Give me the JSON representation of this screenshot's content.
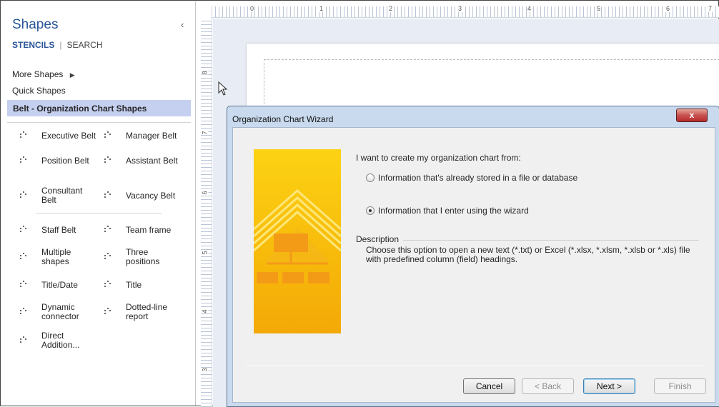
{
  "shapes_pane": {
    "title": "Shapes",
    "collapse_glyph": "‹",
    "tabs": {
      "stencils": "STENCILS",
      "search": "SEARCH"
    },
    "more_shapes": "More Shapes",
    "more_shapes_arrow": "▶",
    "quick_shapes": "Quick Shapes",
    "selected_stencil": "Belt - Organization Chart Shapes",
    "shapes": [
      "Executive Belt",
      "Manager Belt",
      "Position Belt",
      "Assistant Belt",
      "Consultant Belt",
      "Vacancy Belt",
      "Staff Belt",
      "Team frame",
      "Multiple shapes",
      "Three positions",
      "Title/Date",
      "Title",
      "Dynamic connector",
      "Dotted-line report",
      "Direct Addition..."
    ]
  },
  "ruler": {
    "top_numbers": [
      "0",
      "1",
      "2",
      "3",
      "4",
      "5",
      "6",
      "7"
    ],
    "left_numbers": [
      "8",
      "7",
      "6",
      "5",
      "4",
      "3"
    ]
  },
  "dialog": {
    "title": "Organization Chart Wizard",
    "close": "x",
    "intro": "I want to create my organization chart from:",
    "options": [
      {
        "label": "Information that's already stored in a file or database",
        "selected": false
      },
      {
        "label": "Information that I enter using the wizard",
        "selected": true
      }
    ],
    "description_heading": "Description",
    "description": "Choose this option to open a new text (*.txt) or Excel (*.xlsx, *.xlsm, *.xlsb or *.xls) file with predefined column (field) headings.",
    "buttons": {
      "cancel": "Cancel",
      "back": "< Back",
      "next": "Next >",
      "finish": "Finish"
    }
  },
  "colors": {
    "accent": "#2a5699",
    "selection": "#c5cff0",
    "art_yellow": "#f7b90a"
  }
}
